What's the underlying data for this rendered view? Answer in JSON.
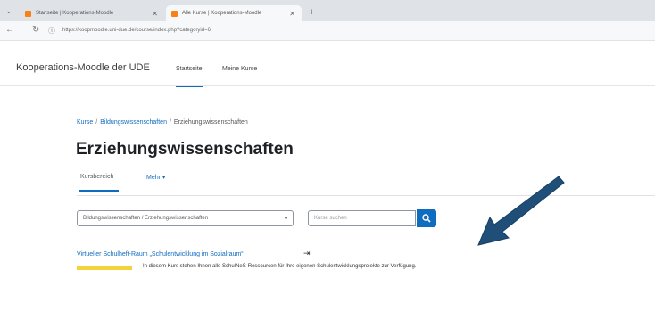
{
  "browser": {
    "tabs": [
      {
        "label": "Startseite | Kooperations-Moodle"
      },
      {
        "label": "Alle Kurse | Kooperations-Moodle"
      }
    ],
    "url": "https://koopmoodle.uni-due.de/course/index.php?categoryid=6"
  },
  "site": {
    "name": "Kooperations-Moodle der UDE",
    "nav": [
      "Startseite",
      "Meine Kurse"
    ]
  },
  "breadcrumb": [
    "Kurse",
    "Bildungswissenschaften",
    "Erziehungswissenschaften"
  ],
  "page_title": "Erziehungswissenschaften",
  "secondary_tabs": [
    "Kursbereich",
    "Mehr ▾"
  ],
  "category_select": "Bildungswissenschaften / Erziehungswissenschaften",
  "search_placeholder": "Kurse suchen",
  "course": {
    "name": "Virtueller Schulheft-Raum „Schulentwicklung im Sozialraum“",
    "summary": "In diesem Kurs stehen Ihnen alle SchulNeS-Ressourcen für Ihre eigenen Schulentwicklungsprojekte zur Verfügung."
  },
  "colors": {
    "accent": "#0f6cbf",
    "arrow": "#1f4e79",
    "highlight": "#f4d23c"
  }
}
